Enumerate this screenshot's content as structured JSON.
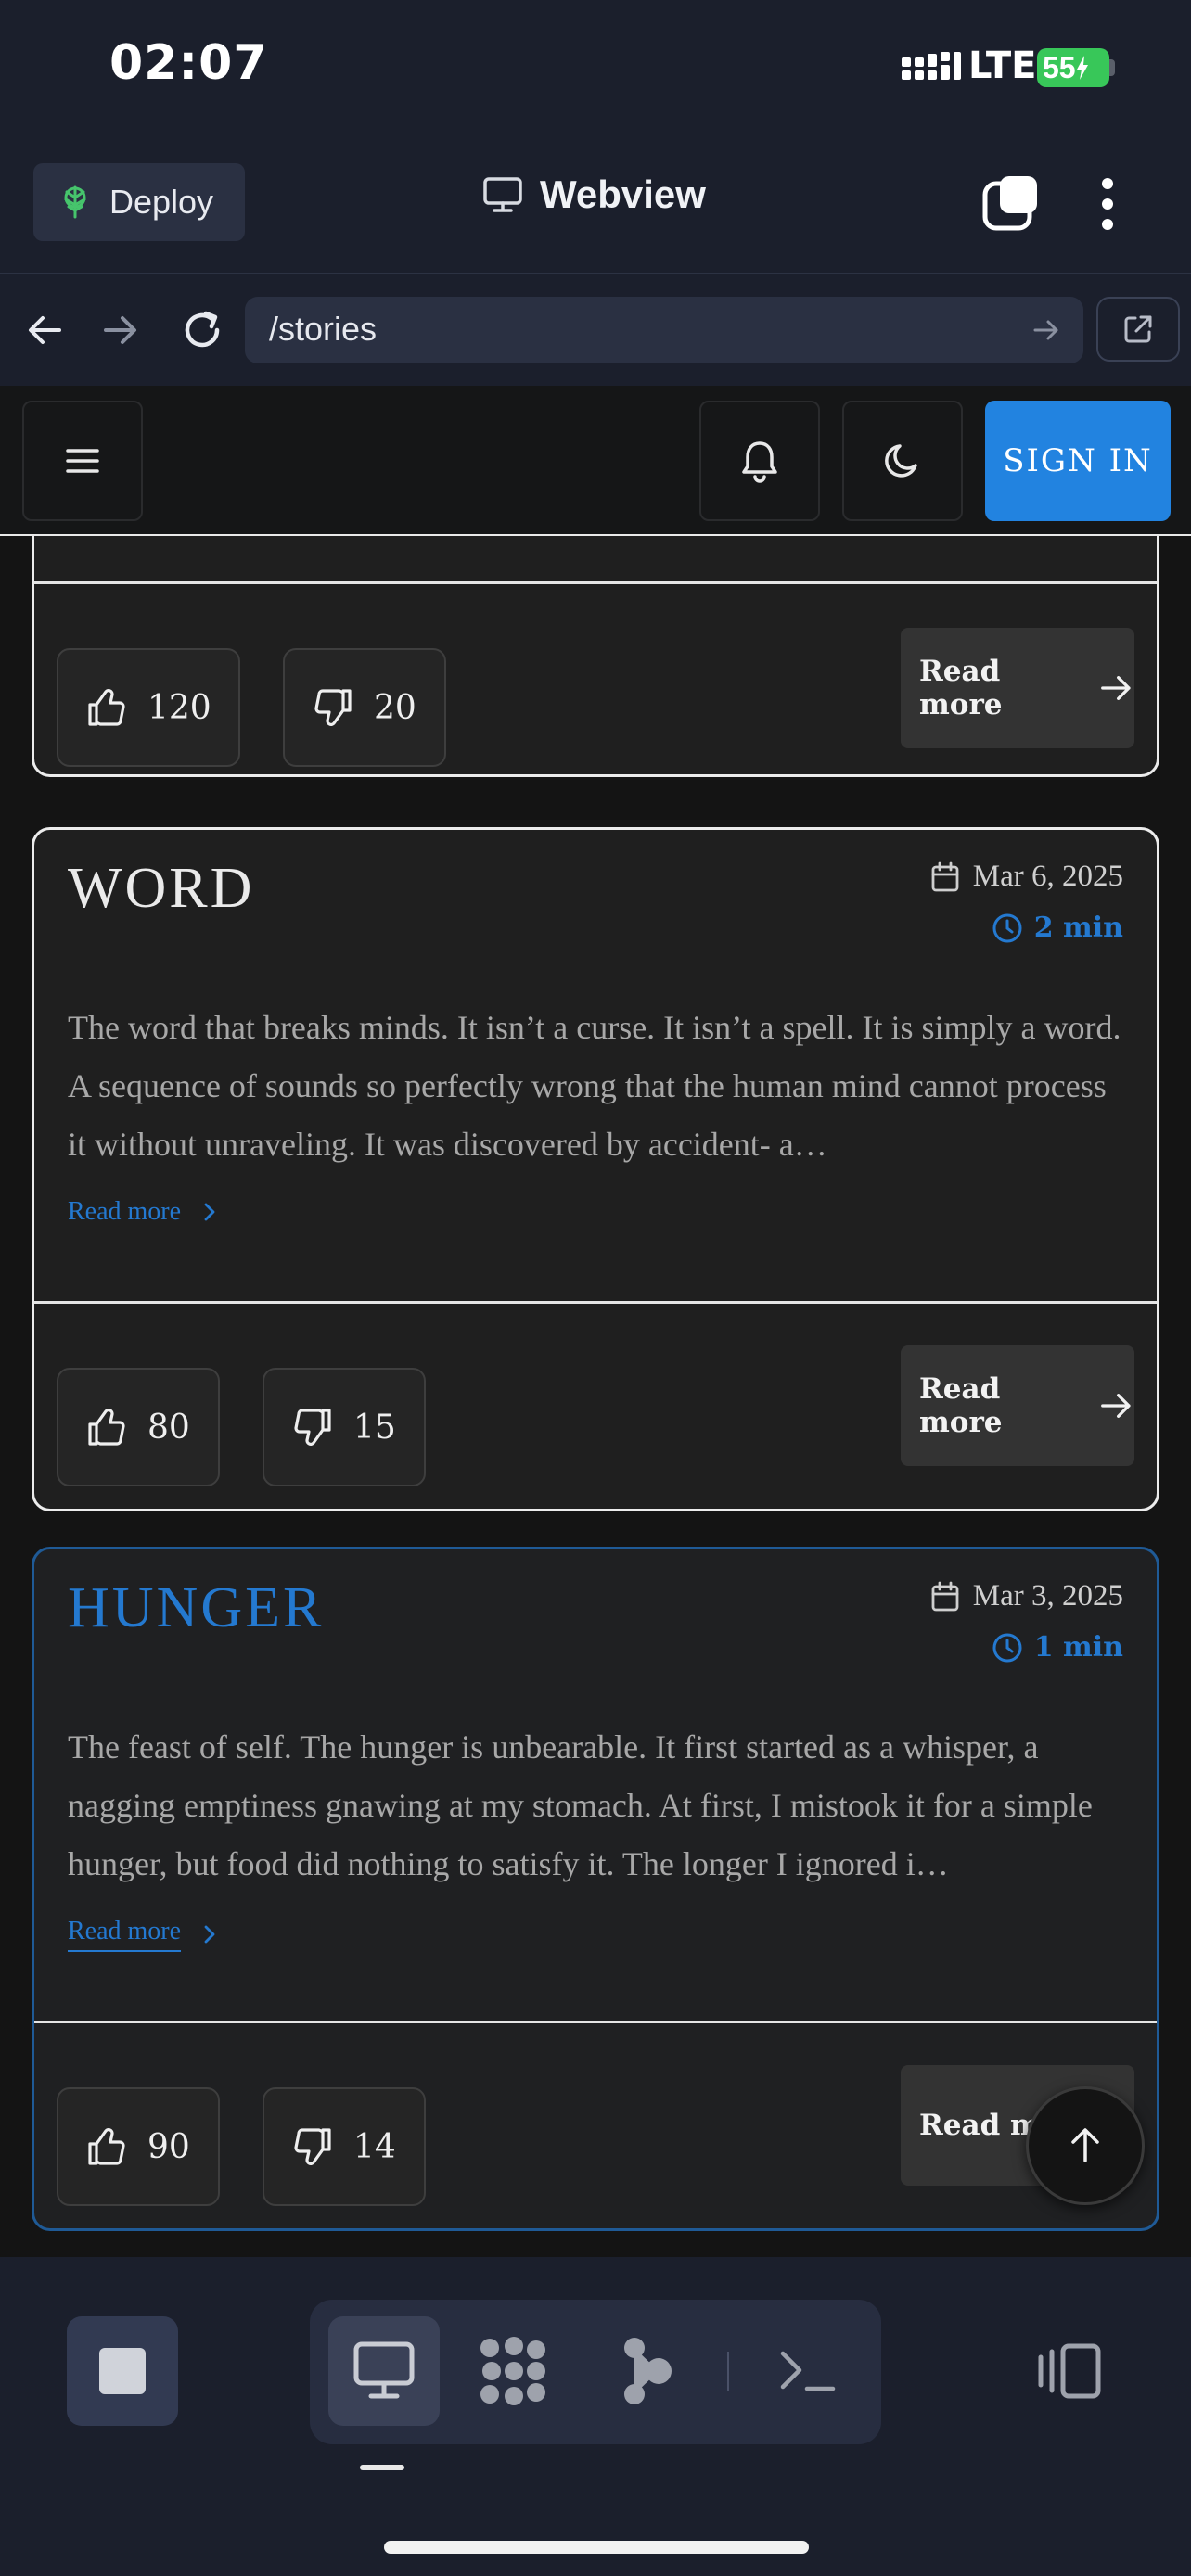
{
  "status_bar": {
    "time": "02:07",
    "network": "LTE",
    "battery": "55"
  },
  "app_header": {
    "deploy_label": "Deploy",
    "title": "Webview"
  },
  "url_bar": {
    "url": "/stories"
  },
  "site_nav": {
    "signin_label": "SIGN IN"
  },
  "stories": [
    {
      "title": "",
      "likes": "120",
      "dislikes": "20",
      "read_more": "Read more"
    },
    {
      "title": "WORD",
      "date": "Mar 6, 2025",
      "read_time": "2 min",
      "excerpt": "The word that breaks minds. It isn’t a curse. It isn’t a spell. It is simply a word. A sequence of sounds so perfectly wrong that the human mind cannot process it without unraveling. It was discovered by accident- a…",
      "inline_read_more": "Read more",
      "likes": "80",
      "dislikes": "15",
      "read_more": "Read more"
    },
    {
      "title": "HUNGER",
      "date": "Mar 3, 2025",
      "read_time": "1 min",
      "excerpt": "The feast of self. The hunger is unbearable. It first started as a whisper, a nagging emptiness gnawing at my stomach. At first, I mistook it for a simple hunger, but food did nothing to satisfy it. The longer I ignored i…",
      "inline_read_more": "Read more",
      "likes": "90",
      "dislikes": "14",
      "read_more": "Read mo"
    }
  ],
  "colors": {
    "accent": "#2283e0",
    "title_highlight": "#2479d0",
    "battery": "#38c759"
  },
  "icons": [
    "deploy-icon",
    "monitor-icon",
    "tabs-icon",
    "kebab-icon",
    "back-icon",
    "forward-icon",
    "reload-icon",
    "external-link-icon",
    "menu-icon",
    "bell-icon",
    "moon-icon",
    "thumbs-up-icon",
    "thumbs-down-icon",
    "calendar-icon",
    "clock-icon",
    "arrow-right-icon",
    "chevron-right-icon",
    "arrow-up-icon",
    "stop-icon",
    "desktop-icon",
    "grid-icon",
    "share-icon",
    "terminal-icon",
    "sidebar-toggle-icon"
  ]
}
